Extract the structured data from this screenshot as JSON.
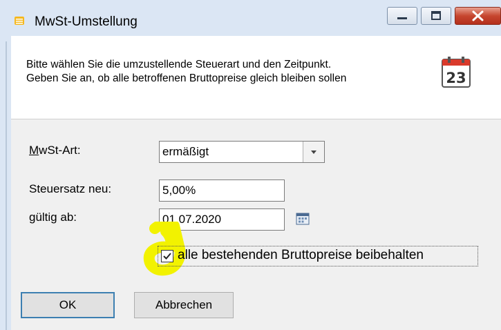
{
  "window": {
    "title": "MwSt-Umstellung"
  },
  "header": {
    "line1": "Bitte wählen Sie die umzustellende Steuerart und den Zeitpunkt.",
    "line2": "Geben Sie an, ob alle betroffenen Bruttopreise gleich bleiben sollen",
    "calendar_day": "23"
  },
  "form": {
    "mwst_art_label": "MwSt-Art:",
    "mwst_art_value": "ermäßigt",
    "steuersatz_label": "Steuersatz neu:",
    "steuersatz_value": "5,00%",
    "gueltig_label": "gültig ab:",
    "gueltig_value": "01.07.2020",
    "checkbox_label": "alle bestehenden Bruttopreise beibehalten",
    "checkbox_checked": true
  },
  "buttons": {
    "ok": "OK",
    "cancel": "Abbrechen"
  },
  "colors": {
    "highlight": "#f2f200",
    "close_button": "#c6462f",
    "calendar_red": "#d93a2b"
  }
}
